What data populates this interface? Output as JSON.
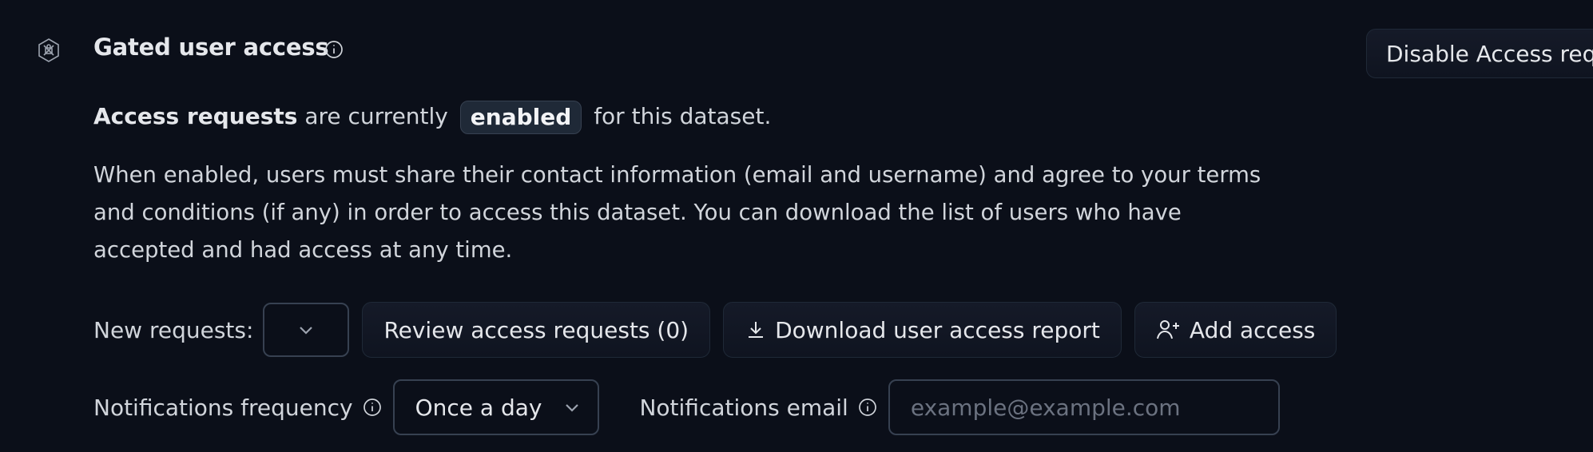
{
  "section": {
    "title": "Gated user access",
    "disable_button_label": "Disable Access req"
  },
  "status": {
    "prefix_bold": "Access requests",
    "prefix": "are currently",
    "state_badge": "enabled",
    "suffix": "for this dataset."
  },
  "description": "When enabled, users must share their contact information (email and username) and agree to your terms and conditions (if any) in order to access this dataset. You can download the list of users who have accepted and had access at any time.",
  "requests_row": {
    "label": "New requests:",
    "review_button": "Review access requests (0)",
    "download_button": "Download user access report",
    "add_button": "Add access"
  },
  "notifications": {
    "frequency_label": "Notifications frequency",
    "frequency_value": "Once a day",
    "email_label": "Notifications email",
    "email_placeholder": "example@example.com",
    "email_value": ""
  },
  "icons": {
    "gate": "gated-access-icon",
    "info": "info-icon",
    "chevron": "chevron-down-icon",
    "download": "download-icon",
    "add_user": "add-user-icon"
  },
  "colors": {
    "background": "#0b0f19",
    "border": "#374151",
    "text": "#d1d5db",
    "heading": "#e5e7eb"
  }
}
